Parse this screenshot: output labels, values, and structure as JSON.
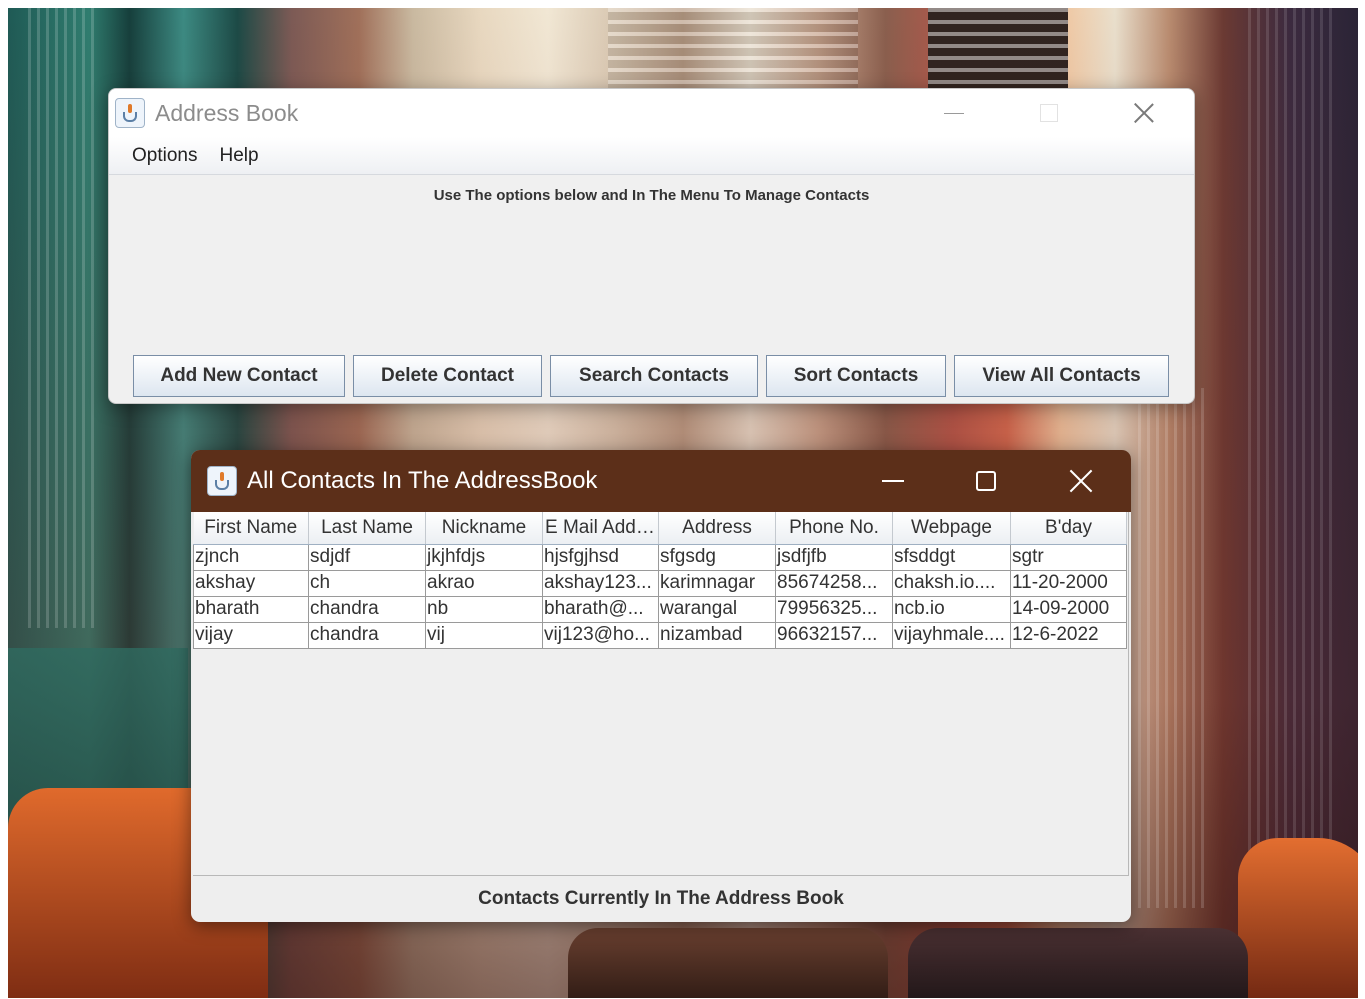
{
  "address_book": {
    "title": "Address Book",
    "menu": [
      "Options",
      "Help"
    ],
    "instructions": "Use The options below and In The Menu To Manage Contacts",
    "buttons": {
      "add": "Add New Contact",
      "delete": "Delete Contact",
      "search": "Search Contacts",
      "sort": "Sort Contacts",
      "view_all": "View All Contacts"
    }
  },
  "contacts_window": {
    "title": "All Contacts In The AddressBook",
    "columns": [
      "First Name",
      "Last Name",
      "Nickname",
      "E Mail Addr...",
      "Address",
      "Phone No.",
      "Webpage",
      "B'day"
    ],
    "rows": [
      [
        "zjnch",
        "sdjdf",
        "jkjhfdjs",
        "hjsfgjhsd",
        "sfgsdg",
        "jsdfjfb",
        "sfsddgt",
        "sgtr"
      ],
      [
        "akshay",
        "ch",
        "akrao",
        "akshay123...",
        "karimnagar",
        "85674258...",
        "chaksh.io....",
        "11-20-2000"
      ],
      [
        "bharath",
        "chandra",
        "nb",
        "bharath@...",
        "warangal",
        "79956325...",
        "ncb.io",
        "14-09-2000"
      ],
      [
        "vijay",
        "chandra",
        "vij",
        "vij123@ho...",
        "nizambad",
        "96632157...",
        "vijayhmale....",
        "12-6-2022"
      ]
    ],
    "footer": "Contacts Currently In The Address Book"
  },
  "colors": {
    "contacts_titlebar": "#5c2f19",
    "window_bg": "#f0f0f0",
    "button_border": "#7a8ea6"
  }
}
